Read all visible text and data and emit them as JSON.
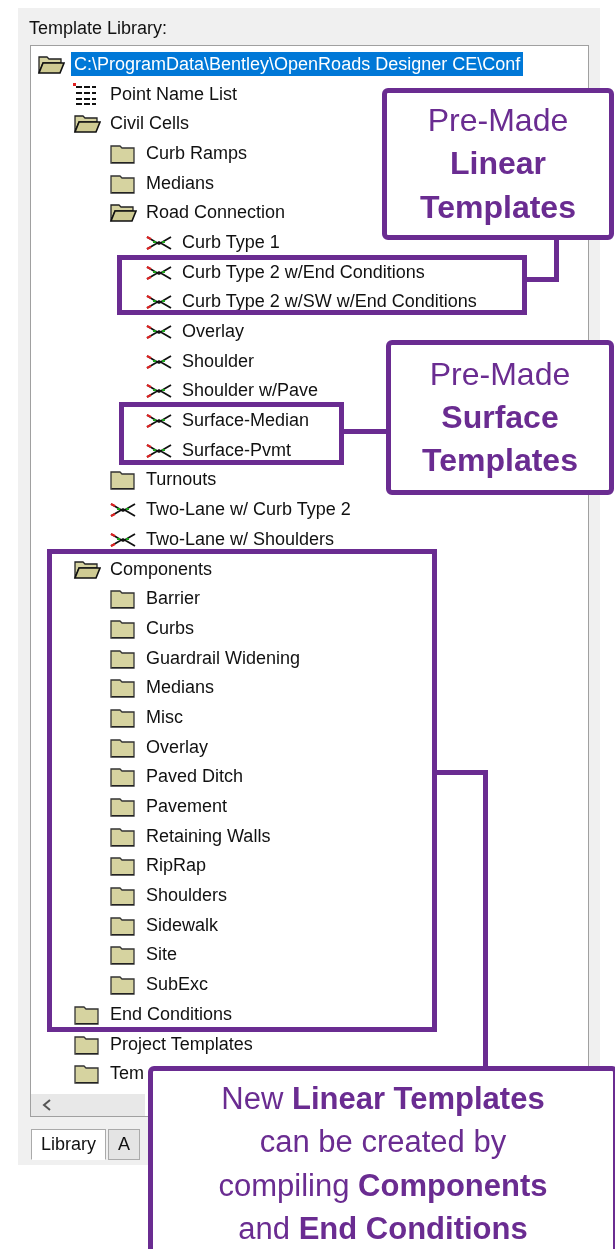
{
  "panel": {
    "label": "Template Library:"
  },
  "tree": [
    {
      "label": "C:\\ProgramData\\Bentley\\OpenRoads Designer CE\\Conf",
      "kind": "folder",
      "expanded": true,
      "selected": true,
      "children": [
        {
          "label": "Point Name List",
          "kind": "list",
          "selected": false
        },
        {
          "label": "Civil Cells",
          "kind": "folder",
          "expanded": true,
          "selected": false,
          "children": [
            {
              "label": "Curb Ramps",
              "kind": "folder",
              "expanded": false,
              "selected": false
            },
            {
              "label": "Medians",
              "kind": "folder",
              "expanded": false,
              "selected": false
            },
            {
              "label": "Road Connection",
              "kind": "folder",
              "expanded": true,
              "selected": false,
              "children": [
                {
                  "label": "Curb Type 1",
                  "kind": "template",
                  "selected": false
                },
                {
                  "label": "Curb Type 2 w/End Conditions",
                  "kind": "template",
                  "selected": false
                },
                {
                  "label": "Curb Type 2 w/SW w/End Conditions",
                  "kind": "template",
                  "selected": false
                },
                {
                  "label": "Overlay",
                  "kind": "template",
                  "selected": false
                },
                {
                  "label": "Shoulder",
                  "kind": "template",
                  "selected": false
                },
                {
                  "label": "Shoulder w/Pave",
                  "kind": "template",
                  "selected": false
                },
                {
                  "label": "Surface-Median",
                  "kind": "template",
                  "selected": false
                },
                {
                  "label": "Surface-Pvmt",
                  "kind": "template",
                  "selected": false
                }
              ]
            },
            {
              "label": "Turnouts",
              "kind": "folder",
              "expanded": false,
              "selected": false
            },
            {
              "label": "Two-Lane w/ Curb Type 2",
              "kind": "template",
              "selected": false
            },
            {
              "label": "Two-Lane w/ Shoulders",
              "kind": "template",
              "selected": false
            }
          ]
        },
        {
          "label": "Components",
          "kind": "folder",
          "expanded": true,
          "selected": false,
          "children": [
            {
              "label": "Barrier",
              "kind": "folder",
              "expanded": false,
              "selected": false
            },
            {
              "label": "Curbs",
              "kind": "folder",
              "expanded": false,
              "selected": false
            },
            {
              "label": "Guardrail Widening",
              "kind": "folder",
              "expanded": false,
              "selected": false
            },
            {
              "label": "Medians",
              "kind": "folder",
              "expanded": false,
              "selected": false
            },
            {
              "label": "Misc",
              "kind": "folder",
              "expanded": false,
              "selected": false
            },
            {
              "label": "Overlay",
              "kind": "folder",
              "expanded": false,
              "selected": false
            },
            {
              "label": "Paved Ditch",
              "kind": "folder",
              "expanded": false,
              "selected": false
            },
            {
              "label": "Pavement",
              "kind": "folder",
              "expanded": false,
              "selected": false
            },
            {
              "label": "Retaining Walls",
              "kind": "folder",
              "expanded": false,
              "selected": false
            },
            {
              "label": "RipRap",
              "kind": "folder",
              "expanded": false,
              "selected": false
            },
            {
              "label": "Shoulders",
              "kind": "folder",
              "expanded": false,
              "selected": false
            },
            {
              "label": "Sidewalk",
              "kind": "folder",
              "expanded": false,
              "selected": false
            },
            {
              "label": "Site",
              "kind": "folder",
              "expanded": false,
              "selected": false
            },
            {
              "label": "SubExc",
              "kind": "folder",
              "expanded": false,
              "selected": false
            }
          ]
        },
        {
          "label": "End Conditions",
          "kind": "folder",
          "expanded": false,
          "selected": false
        },
        {
          "label": "Project Templates",
          "kind": "folder",
          "expanded": false,
          "selected": false
        },
        {
          "label": "Tem",
          "kind": "folder",
          "expanded": false,
          "selected": false
        }
      ]
    }
  ],
  "tabs": [
    {
      "label": "Library",
      "selected": true
    },
    {
      "label": "A",
      "selected": false
    }
  ],
  "callouts": [
    "Pre-Made\n**Linear**\n**Templates**",
    "Pre-Made\n**Surface**\n**Templates**",
    "New **Linear Templates**\ncan be created by\ncompiling **Components**\nand **End Conditions**"
  ]
}
